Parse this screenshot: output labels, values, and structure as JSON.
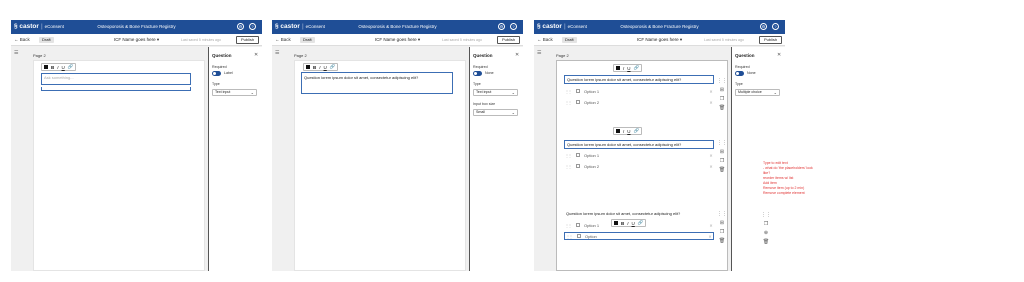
{
  "header": {
    "logo": "castor",
    "product": "eConsent",
    "app_title": "Osteoporosis & Bone Fracture Registry",
    "back_label": "Back",
    "draft_label": "Draft",
    "form_name": "ICF Name goes here ▾",
    "last_saved": "Last saved 5 minutes ago",
    "publish_label": "Publish"
  },
  "page_label": "Page 2",
  "toolbar": {
    "bold": "B",
    "italic": "I",
    "underline": "U",
    "link": "🔗"
  },
  "screens": [
    {
      "question_placeholder": "Ask something...",
      "panel": {
        "title": "Question",
        "required_label": "Required",
        "toggle_label": "Label",
        "type_label": "Type",
        "type_value": "Text input"
      }
    },
    {
      "question_text": "Question lorem ipsum dolor sit amet, consectetur adipiscing elit?",
      "panel": {
        "title": "Question",
        "required_label": "Required",
        "toggle_label": "None",
        "type_label": "Type",
        "type_value": "Text input",
        "size_label": "Input box size",
        "size_value": "Small"
      }
    },
    {
      "questions": [
        {
          "text": "Question lorem ipsum dolor sit amet, consectetur adipiscing elit?",
          "options": [
            "Option 1",
            "Option 2"
          ]
        },
        {
          "text": "Question lorem ipsum dolor sit amet, consectetur adipiscing elit?",
          "options": [
            "Option 1",
            "Option 2"
          ]
        },
        {
          "text": "Question lorem ipsum dolor sit amet, consectetur adipiscing elit?",
          "options": [
            "Option 1",
            "Option"
          ]
        }
      ],
      "panel": {
        "title": "Question",
        "required_label": "Required",
        "toggle_label": "None",
        "type_label": "Type",
        "type_value": "Multiple choice"
      },
      "note": "Type to edit text\n- what do 'the placeholders' look like?\nreorder items w/ list\nAdd item\nRemove item (up to 2 min)\nRemove complete element"
    }
  ],
  "icons": {
    "settings": "gear-icon",
    "help": "help-icon",
    "close": "close-icon",
    "drag": "drag-handle-icon",
    "copy": "copy-icon",
    "delete": "trash-icon",
    "add": "add-icon"
  }
}
